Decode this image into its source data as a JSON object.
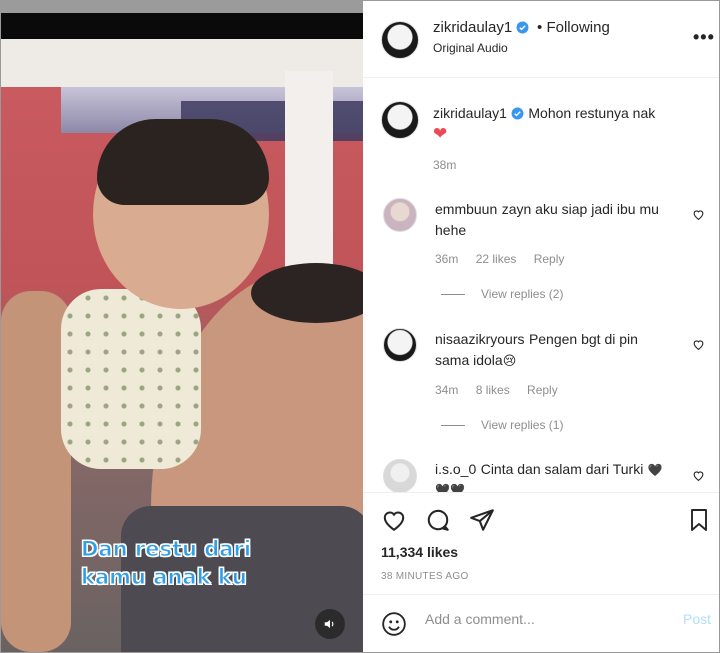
{
  "video": {
    "caption_line1": "Dan restu dari",
    "caption_line2": "kamu anak ku",
    "icons": {
      "volume": "volume-icon"
    }
  },
  "header": {
    "username": "zikridaulay1",
    "separator": "•",
    "follow_status": "Following",
    "subtitle": "Original Audio",
    "more": "•••"
  },
  "caption_post": {
    "username": "zikridaulay1",
    "text": "Mohon restunya nak",
    "emoji": "❤",
    "time": "38m"
  },
  "comments": [
    {
      "username": "emmbuun",
      "text": "zayn aku siap jadi ibu mu hehe",
      "time": "36m",
      "likes": "22 likes",
      "reply": "Reply",
      "view_replies": "View replies (2)"
    },
    {
      "username": "nisaazikryours",
      "text": "Pengen bgt di pin sama idola",
      "emoji": "😢",
      "time": "34m",
      "likes": "8 likes",
      "reply": "Reply",
      "view_replies": "View replies (1)"
    },
    {
      "username": "i.s.o_0",
      "text": "Cinta dan salam dari Turki",
      "emoji": "🖤🖤🖤"
    }
  ],
  "actions": {
    "likes": "11,334 likes",
    "time_ago": "38 MINUTES AGO"
  },
  "add_comment": {
    "placeholder": "Add a comment...",
    "post_label": "Post"
  },
  "colors": {
    "verified": "#3897f0",
    "heart": "#ed4956",
    "muted_text": "#8e8e8e",
    "post_disabled": "#b2dffc",
    "caption_text": "#2f9ee8"
  }
}
